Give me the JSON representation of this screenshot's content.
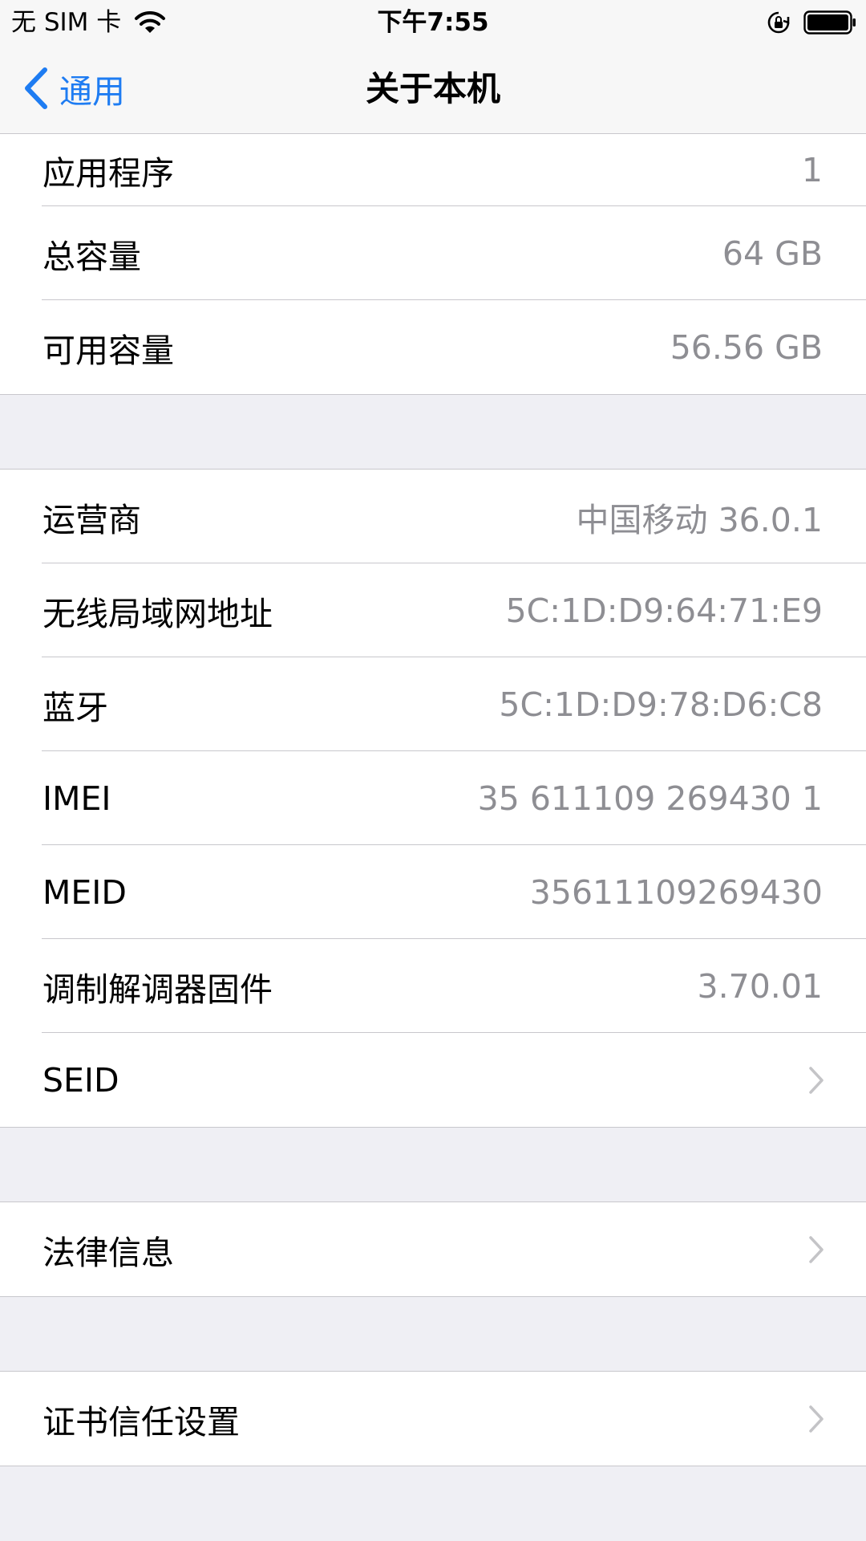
{
  "status_bar": {
    "carrier": "无 SIM 卡",
    "time": "下午7:55"
  },
  "nav": {
    "back_label": "通用",
    "title": "关于本机"
  },
  "sections": [
    {
      "rows": [
        {
          "label": "应用程序",
          "value": "1"
        },
        {
          "label": "总容量",
          "value": "64 GB"
        },
        {
          "label": "可用容量",
          "value": "56.56 GB"
        }
      ]
    },
    {
      "rows": [
        {
          "label": "运营商",
          "value": "中国移动 36.0.1"
        },
        {
          "label": "无线局域网地址",
          "value": "5C:1D:D9:64:71:E9"
        },
        {
          "label": "蓝牙",
          "value": "5C:1D:D9:78:D6:C8"
        },
        {
          "label": "IMEI",
          "value": "35 611109 269430 1"
        },
        {
          "label": "MEID",
          "value": "35611109269430"
        },
        {
          "label": "调制解调器固件",
          "value": "3.70.01"
        },
        {
          "label": "SEID",
          "value": ""
        }
      ]
    },
    {
      "rows": [
        {
          "label": "法律信息",
          "value": ""
        }
      ]
    },
    {
      "rows": [
        {
          "label": "证书信任设置",
          "value": ""
        }
      ]
    }
  ],
  "colors": {
    "accent": "#1e7cf2",
    "secondary_text": "#8e8e93",
    "grouped_background": "#efeff4",
    "separator": "#c8c7cc"
  },
  "icons": [
    "wifi-icon",
    "rotation-lock-icon",
    "battery-icon",
    "back-chevron-icon",
    "chevron-right-icon"
  ]
}
